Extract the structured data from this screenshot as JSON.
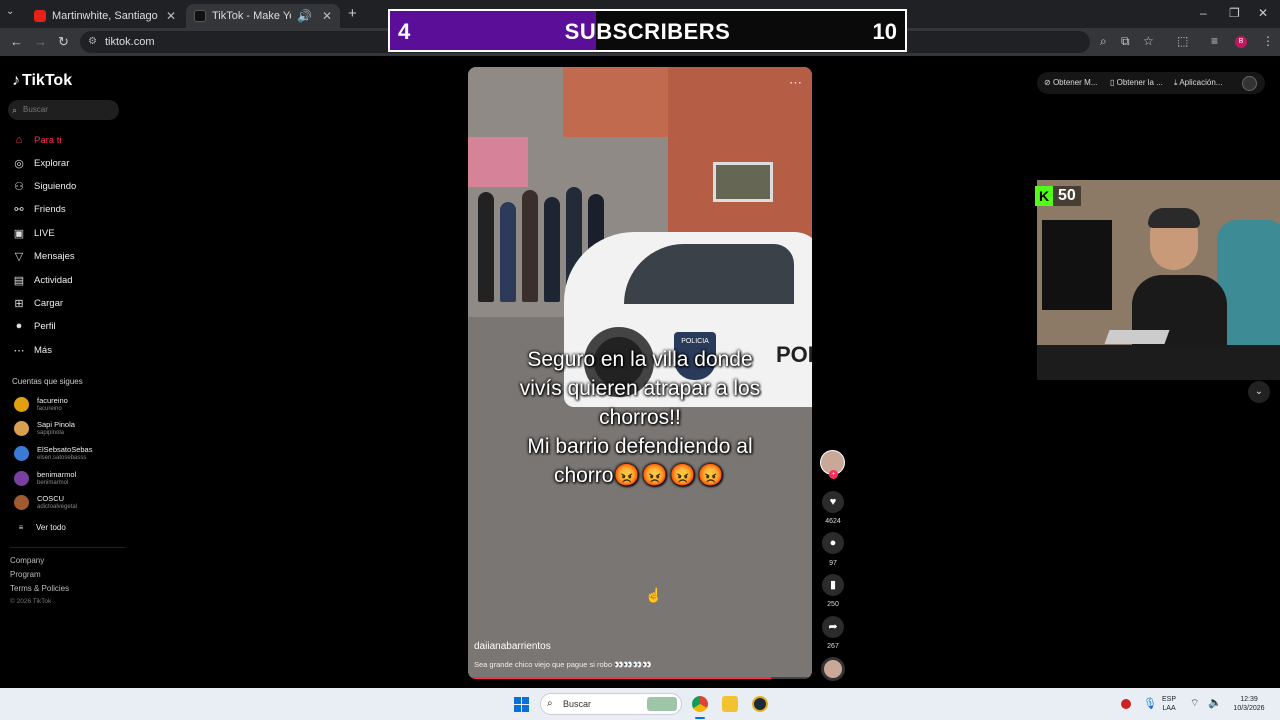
{
  "browser": {
    "tabs": [
      {
        "label": "Martinwhite, Santiago Berrio - A",
        "close": "✕"
      },
      {
        "label": "TikTok - Make Your Day",
        "close": "✕"
      }
    ],
    "new_tab": "+",
    "url": "tiktok.com",
    "window_controls": [
      "–",
      "❐",
      "✕"
    ]
  },
  "overlay": {
    "left_count": "4",
    "label": "SUBSCRIBERS",
    "right_count": "10",
    "progress": 0.4,
    "fill_color": "#5b0f99"
  },
  "tiktok": {
    "logo": "TikTok",
    "search_placeholder": "Buscar",
    "nav": [
      {
        "label": "Para ti",
        "icon": "home-icon",
        "active": true
      },
      {
        "label": "Explorar",
        "icon": "compass-icon"
      },
      {
        "label": "Siguiendo",
        "icon": "following-icon"
      },
      {
        "label": "Friends",
        "icon": "friends-icon"
      },
      {
        "label": "LIVE",
        "icon": "live-icon"
      },
      {
        "label": "Mensajes",
        "icon": "messages-icon"
      },
      {
        "label": "Actividad",
        "icon": "activity-icon"
      },
      {
        "label": "Cargar",
        "icon": "upload-icon"
      },
      {
        "label": "Perfil",
        "icon": "profile-icon"
      },
      {
        "label": "Más",
        "icon": "more-icon"
      }
    ],
    "following_header": "Cuentas que sigues",
    "accounts": [
      {
        "name": "facureino",
        "handle": "facureino",
        "color": "#e0a010"
      },
      {
        "name": "Sapi Pinola",
        "handle": "sapipinola",
        "color": "#d9a050"
      },
      {
        "name": "ElSebsatoSebas",
        "handle": "elsen.satosebasss",
        "color": "#3a7bd5"
      },
      {
        "name": "benimarmol",
        "handle": "benimarmol",
        "color": "#7a3fa0"
      },
      {
        "name": "COSCU",
        "handle": "adictoalvegetal",
        "color": "#a05a30"
      }
    ],
    "see_all": "Ver todo",
    "footer_links": [
      "Company",
      "Program",
      "Terms & Policies"
    ],
    "copyright": "© 2026 TikTok",
    "top_buttons": [
      "Obtener M...",
      "Obtener la ...",
      "Aplicación..."
    ]
  },
  "video": {
    "caption_lines": [
      "Seguro en la villa donde",
      "vivís quieren atrapar a los",
      "chorros!!",
      "Mi barrio defendiendo al",
      "chorro"
    ],
    "caption_emoji": "😡😡😡😡",
    "car_text": "POL",
    "badge_text": "POLICIA",
    "username": "daiianabarrientos",
    "description": "Sea grande chico viejo que pague si robo 👀👀👀👀",
    "progress": 0.88,
    "menu": "⋯"
  },
  "actions": {
    "likes": "4624",
    "comments": "97",
    "saves": "250",
    "shares": "267"
  },
  "stream": {
    "kick_logo": "K",
    "viewers": "50",
    "kick_color": "#53fc18"
  },
  "taskbar": {
    "search": "Buscar",
    "lang_top": "ESP",
    "lang_bottom": "LAA",
    "time": "12:39",
    "date": "10/3/2026"
  }
}
